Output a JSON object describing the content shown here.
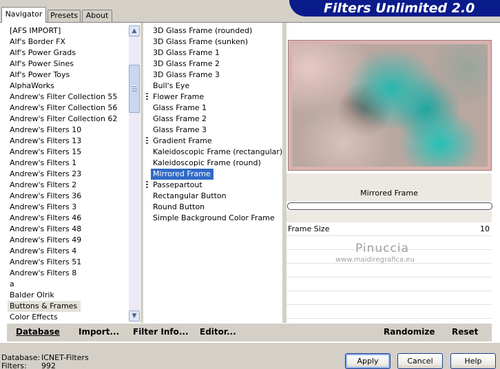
{
  "app": {
    "title": "Filters Unlimited 2.0"
  },
  "tabs": [
    {
      "label": "Navigator",
      "active": true
    },
    {
      "label": "Presets",
      "active": false
    },
    {
      "label": "About",
      "active": false
    }
  ],
  "categories": [
    "[AFS IMPORT]",
    "Alf's Border FX",
    "Alf's Power Grads",
    "Alf's Power Sines",
    "Alf's Power Toys",
    "AlphaWorks",
    "Andrew's Filter Collection 55",
    "Andrew's Filter Collection 56",
    "Andrew's Filter Collection 62",
    "Andrew's Filters 10",
    "Andrew's Filters 13",
    "Andrew's Filters 15",
    "Andrew's Filters 1",
    "Andrew's Filters 23",
    "Andrew's Filters 2",
    "Andrew's Filters 36",
    "Andrew's Filters 3",
    "Andrew's Filters 46",
    "Andrew's Filters 48",
    "Andrew's Filters 49",
    "Andrew's Filters 4",
    "Andrew's Filters 51",
    "Andrew's Filters 8",
    "a",
    "Balder Olrik",
    "Buttons & Frames",
    "Color Effects"
  ],
  "selected_category": "Buttons & Frames",
  "filters": [
    {
      "label": "3D Glass Frame (rounded)",
      "group": false
    },
    {
      "label": "3D Glass Frame (sunken)",
      "group": false
    },
    {
      "label": "3D Glass Frame 1",
      "group": false
    },
    {
      "label": "3D Glass Frame 2",
      "group": false
    },
    {
      "label": "3D Glass Frame 3",
      "group": false
    },
    {
      "label": "Bull's Eye",
      "group": false
    },
    {
      "label": "Flower Frame",
      "group": true
    },
    {
      "label": "Glass Frame 1",
      "group": false
    },
    {
      "label": "Glass Frame 2",
      "group": false
    },
    {
      "label": "Glass Frame 3",
      "group": false
    },
    {
      "label": "Gradient Frame",
      "group": true
    },
    {
      "label": "Kaleidoscopic Frame (rectangular)",
      "group": false
    },
    {
      "label": "Kaleidoscopic Frame (round)",
      "group": false
    },
    {
      "label": "Mirrored Frame",
      "group": false
    },
    {
      "label": "Passepartout",
      "group": true
    },
    {
      "label": "Rectangular Button",
      "group": false
    },
    {
      "label": "Round Button",
      "group": false
    },
    {
      "label": "Simple Background Color Frame",
      "group": false
    }
  ],
  "selected_filter": "Mirrored Frame",
  "preview": {
    "caption": "Mirrored Frame"
  },
  "params": [
    {
      "label": "Frame Size",
      "value": "10"
    }
  ],
  "watermark": {
    "name": "Pinuccia",
    "url": "www.maidiregrafica.eu"
  },
  "bottom_links": {
    "database": "Database",
    "import": "Import...",
    "filter_info": "Filter Info...",
    "editor": "Editor...",
    "randomize": "Randomize",
    "reset": "Reset"
  },
  "status": {
    "database_label": "Database:",
    "database_value": "ICNET-Filters",
    "filters_label": "Filters:",
    "filters_value": "992"
  },
  "buttons": {
    "apply": "Apply",
    "cancel": "Cancel",
    "help": "Help"
  }
}
